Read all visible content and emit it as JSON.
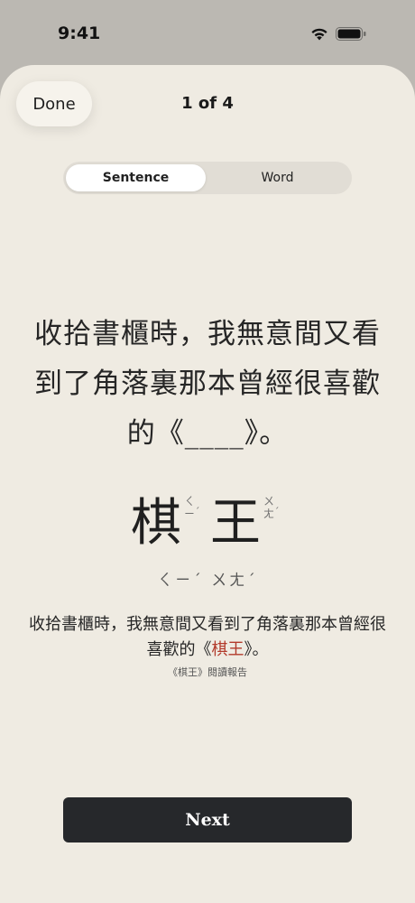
{
  "status_bar": {
    "time": "9:41",
    "icons": [
      "wifi-icon",
      "battery-icon"
    ]
  },
  "header": {
    "done_label": "Done",
    "page_counter": "1 of 4"
  },
  "segmented_control": {
    "options": [
      "Sentence",
      "Word"
    ],
    "selected": "Sentence"
  },
  "card": {
    "sentence": "收拾書櫃時，我無意間又看到了角落裏那本曾經很喜歡的《____》。",
    "word": {
      "chars": [
        "棋",
        "王"
      ],
      "zhuyin": [
        {
          "symbols": [
            "ㄑ",
            "ㄧ"
          ],
          "tone": "ˊ"
        },
        {
          "symbols": [
            "ㄨ",
            "ㄤ"
          ],
          "tone": "ˊ"
        }
      ],
      "bopomofo": "ㄑㄧˊ ㄨㄤˊ"
    },
    "example": {
      "before": "收拾書櫃時，我無意間又看到了角落裏那本曾經很喜歡的《",
      "highlight": "棋王",
      "after": "》。"
    },
    "source": "《棋王》閱讀報告"
  },
  "footer": {
    "next_label": "Next"
  },
  "colors": {
    "background": "#efebe2",
    "highlight": "#b23a2b",
    "button": "#26282b"
  }
}
